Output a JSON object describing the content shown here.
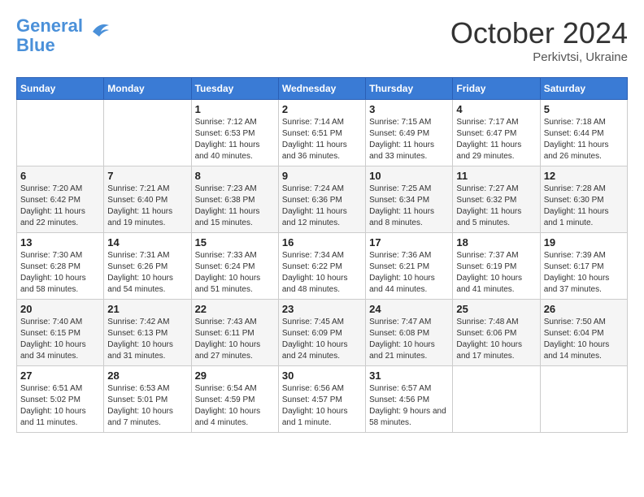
{
  "header": {
    "logo_line1": "General",
    "logo_line2": "Blue",
    "month": "October 2024",
    "location": "Perkivtsi, Ukraine"
  },
  "weekdays": [
    "Sunday",
    "Monday",
    "Tuesday",
    "Wednesday",
    "Thursday",
    "Friday",
    "Saturday"
  ],
  "weeks": [
    [
      {
        "day": "",
        "info": ""
      },
      {
        "day": "",
        "info": ""
      },
      {
        "day": "1",
        "info": "Sunrise: 7:12 AM\nSunset: 6:53 PM\nDaylight: 11 hours and 40 minutes."
      },
      {
        "day": "2",
        "info": "Sunrise: 7:14 AM\nSunset: 6:51 PM\nDaylight: 11 hours and 36 minutes."
      },
      {
        "day": "3",
        "info": "Sunrise: 7:15 AM\nSunset: 6:49 PM\nDaylight: 11 hours and 33 minutes."
      },
      {
        "day": "4",
        "info": "Sunrise: 7:17 AM\nSunset: 6:47 PM\nDaylight: 11 hours and 29 minutes."
      },
      {
        "day": "5",
        "info": "Sunrise: 7:18 AM\nSunset: 6:44 PM\nDaylight: 11 hours and 26 minutes."
      }
    ],
    [
      {
        "day": "6",
        "info": "Sunrise: 7:20 AM\nSunset: 6:42 PM\nDaylight: 11 hours and 22 minutes."
      },
      {
        "day": "7",
        "info": "Sunrise: 7:21 AM\nSunset: 6:40 PM\nDaylight: 11 hours and 19 minutes."
      },
      {
        "day": "8",
        "info": "Sunrise: 7:23 AM\nSunset: 6:38 PM\nDaylight: 11 hours and 15 minutes."
      },
      {
        "day": "9",
        "info": "Sunrise: 7:24 AM\nSunset: 6:36 PM\nDaylight: 11 hours and 12 minutes."
      },
      {
        "day": "10",
        "info": "Sunrise: 7:25 AM\nSunset: 6:34 PM\nDaylight: 11 hours and 8 minutes."
      },
      {
        "day": "11",
        "info": "Sunrise: 7:27 AM\nSunset: 6:32 PM\nDaylight: 11 hours and 5 minutes."
      },
      {
        "day": "12",
        "info": "Sunrise: 7:28 AM\nSunset: 6:30 PM\nDaylight: 11 hours and 1 minute."
      }
    ],
    [
      {
        "day": "13",
        "info": "Sunrise: 7:30 AM\nSunset: 6:28 PM\nDaylight: 10 hours and 58 minutes."
      },
      {
        "day": "14",
        "info": "Sunrise: 7:31 AM\nSunset: 6:26 PM\nDaylight: 10 hours and 54 minutes."
      },
      {
        "day": "15",
        "info": "Sunrise: 7:33 AM\nSunset: 6:24 PM\nDaylight: 10 hours and 51 minutes."
      },
      {
        "day": "16",
        "info": "Sunrise: 7:34 AM\nSunset: 6:22 PM\nDaylight: 10 hours and 48 minutes."
      },
      {
        "day": "17",
        "info": "Sunrise: 7:36 AM\nSunset: 6:21 PM\nDaylight: 10 hours and 44 minutes."
      },
      {
        "day": "18",
        "info": "Sunrise: 7:37 AM\nSunset: 6:19 PM\nDaylight: 10 hours and 41 minutes."
      },
      {
        "day": "19",
        "info": "Sunrise: 7:39 AM\nSunset: 6:17 PM\nDaylight: 10 hours and 37 minutes."
      }
    ],
    [
      {
        "day": "20",
        "info": "Sunrise: 7:40 AM\nSunset: 6:15 PM\nDaylight: 10 hours and 34 minutes."
      },
      {
        "day": "21",
        "info": "Sunrise: 7:42 AM\nSunset: 6:13 PM\nDaylight: 10 hours and 31 minutes."
      },
      {
        "day": "22",
        "info": "Sunrise: 7:43 AM\nSunset: 6:11 PM\nDaylight: 10 hours and 27 minutes."
      },
      {
        "day": "23",
        "info": "Sunrise: 7:45 AM\nSunset: 6:09 PM\nDaylight: 10 hours and 24 minutes."
      },
      {
        "day": "24",
        "info": "Sunrise: 7:47 AM\nSunset: 6:08 PM\nDaylight: 10 hours and 21 minutes."
      },
      {
        "day": "25",
        "info": "Sunrise: 7:48 AM\nSunset: 6:06 PM\nDaylight: 10 hours and 17 minutes."
      },
      {
        "day": "26",
        "info": "Sunrise: 7:50 AM\nSunset: 6:04 PM\nDaylight: 10 hours and 14 minutes."
      }
    ],
    [
      {
        "day": "27",
        "info": "Sunrise: 6:51 AM\nSunset: 5:02 PM\nDaylight: 10 hours and 11 minutes."
      },
      {
        "day": "28",
        "info": "Sunrise: 6:53 AM\nSunset: 5:01 PM\nDaylight: 10 hours and 7 minutes."
      },
      {
        "day": "29",
        "info": "Sunrise: 6:54 AM\nSunset: 4:59 PM\nDaylight: 10 hours and 4 minutes."
      },
      {
        "day": "30",
        "info": "Sunrise: 6:56 AM\nSunset: 4:57 PM\nDaylight: 10 hours and 1 minute."
      },
      {
        "day": "31",
        "info": "Sunrise: 6:57 AM\nSunset: 4:56 PM\nDaylight: 9 hours and 58 minutes."
      },
      {
        "day": "",
        "info": ""
      },
      {
        "day": "",
        "info": ""
      }
    ]
  ]
}
